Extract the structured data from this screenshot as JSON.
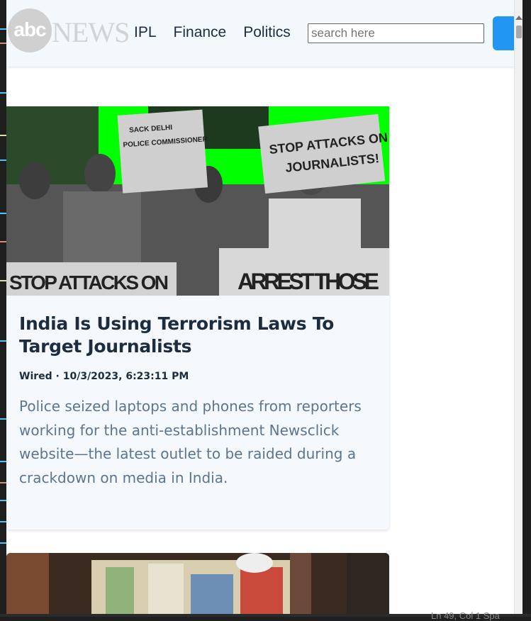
{
  "logo": {
    "abc": "abc",
    "news": "NEWS"
  },
  "nav": {
    "items": [
      "IPL",
      "Finance",
      "Politics"
    ]
  },
  "search": {
    "placeholder": "search here"
  },
  "article": {
    "title": "India Is Using Terrorism Laws To Target Journalists",
    "meta": "Wired · 10/3/2023, 6:23:11 PM",
    "description": "Police seized laptops and phones from reporters working for the anti-establishment Newsclick website—the latest outlet to be raided during a crackdown on media in India.",
    "image_signs": [
      "SACK DELHI POLICE COMMISSIONER",
      "STOP ATTACKS ON JOURNALISTS!",
      "STOP ATTACKS ON",
      "ARREST THOSE"
    ]
  },
  "status_bar": {
    "text": "Ln 49, Col 1  Spa"
  },
  "colors": {
    "accent": "#2196f3",
    "header_bg": "#f3f8fd",
    "title": "#1b2d3e",
    "description": "#5a7590",
    "image_green": "#00ff00"
  }
}
